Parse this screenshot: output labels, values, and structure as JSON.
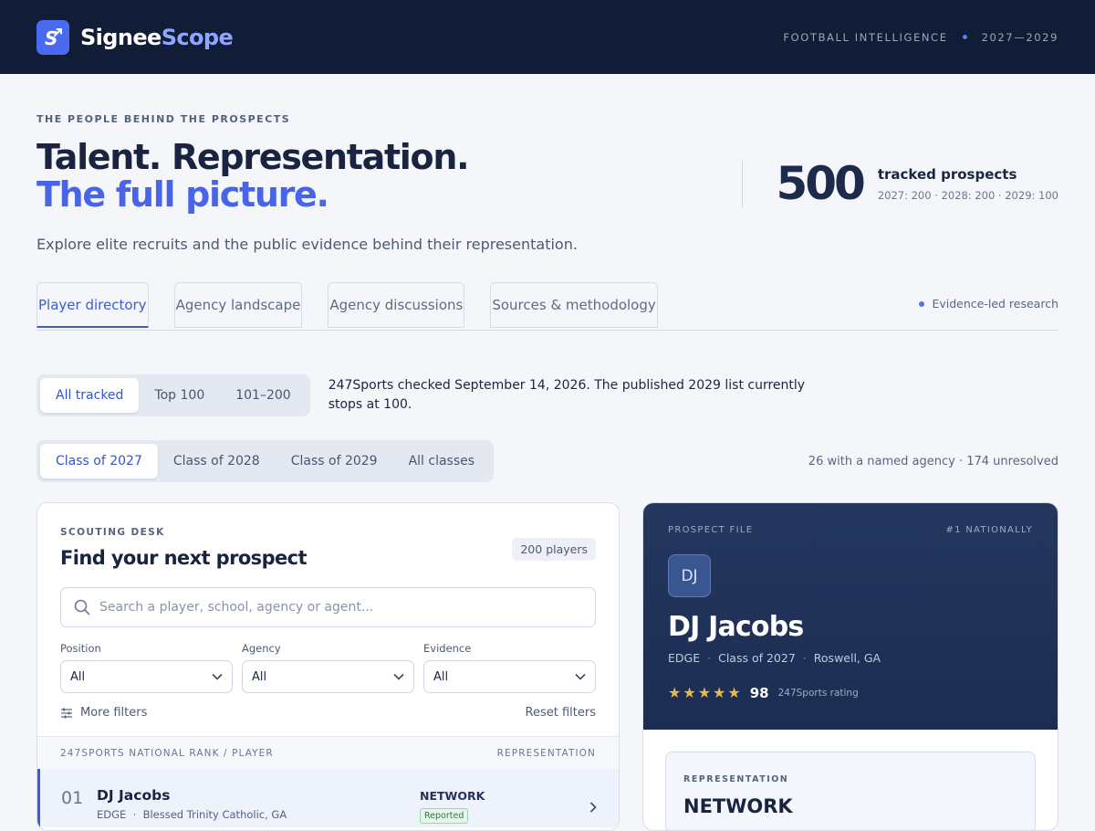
{
  "brand": {
    "name_part1": "Signee",
    "name_part2": "Scope",
    "logo_icon": "logo-icon"
  },
  "topbar": {
    "tagline": "FOOTBALL INTELLIGENCE",
    "years": "2027—2029"
  },
  "hero": {
    "eyebrow": "THE PEOPLE BEHIND THE PROSPECTS",
    "title_line1": "Talent. Representation.",
    "title_line2": "The full picture.",
    "subtitle": "Explore elite recruits and the public evidence behind their representation."
  },
  "stat": {
    "value": "500",
    "label": "tracked prospects",
    "breakdown": "2027: 200 · 2028: 200 · 2029: 100"
  },
  "tabs": [
    {
      "label": "Player directory",
      "active": true
    },
    {
      "label": "Agency landscape",
      "active": false
    },
    {
      "label": "Agency discussions",
      "active": false
    },
    {
      "label": "Sources & methodology",
      "active": false
    }
  ],
  "tab_right": "Evidence-led research",
  "tier_filter": {
    "options": [
      "All tracked",
      "Top 100",
      "101–200"
    ],
    "selected": "All tracked"
  },
  "source_note": "247Sports checked September 14, 2026. The published 2029 list currently stops at 100.",
  "class_filter": {
    "options": [
      "Class of 2027",
      "Class of 2028",
      "Class of 2029",
      "All classes"
    ],
    "selected": "Class of 2027"
  },
  "agency_counts": "26 with a named agency · 174 unresolved",
  "desk": {
    "eyebrow": "SCOUTING DESK",
    "title": "Find your next prospect",
    "count": "200 players",
    "search_placeholder": "Search a player, school, agency or agent...",
    "filters": [
      {
        "label": "Position",
        "value": "All"
      },
      {
        "label": "Agency",
        "value": "All"
      },
      {
        "label": "Evidence",
        "value": "All"
      }
    ],
    "more_filters": "More filters",
    "reset": "Reset filters",
    "list_header_left": "247SPORTS NATIONAL RANK / PLAYER",
    "list_header_right": "REPRESENTATION",
    "rows": [
      {
        "rank": "01",
        "name": "DJ Jacobs",
        "position": "EDGE",
        "school": "Blessed Trinity Catholic, GA",
        "agency": "NETWORK",
        "evidence": "Reported"
      }
    ]
  },
  "prospect_file": {
    "eyebrow": "PROSPECT FILE",
    "rank_label": "#1 NATIONALLY",
    "initials": "DJ",
    "name": "DJ Jacobs",
    "position": "EDGE",
    "class": "Class of 2027",
    "hometown": "Roswell, GA",
    "stars": "★★★★★",
    "star_count": 5,
    "rating": "98",
    "rating_label": "247Sports rating",
    "rep_eyebrow": "REPRESENTATION",
    "rep_name": "NETWORK"
  },
  "colors": {
    "nav_bg": "#111d36",
    "accent": "#4864e8",
    "file_bg": "#24375f",
    "star": "#e8b84f"
  }
}
